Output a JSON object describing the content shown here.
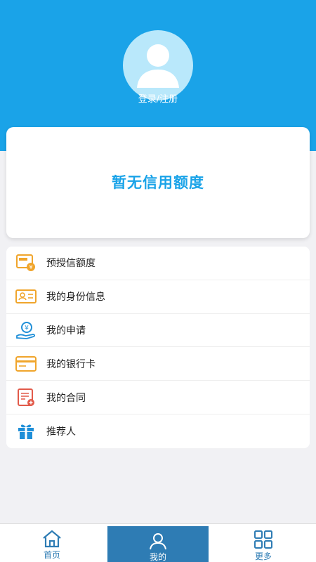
{
  "header": {
    "login_label": "登录/注册"
  },
  "credit": {
    "status_text": "暂无信用额度"
  },
  "menu": {
    "items": [
      {
        "label": "预授信额度",
        "icon": "pre-credit-icon"
      },
      {
        "label": "我的身份信息",
        "icon": "id-card-icon"
      },
      {
        "label": "我的申请",
        "icon": "yuan-hand-icon"
      },
      {
        "label": "我的银行卡",
        "icon": "bank-card-icon"
      },
      {
        "label": "我的合同",
        "icon": "contract-icon"
      },
      {
        "label": "推荐人",
        "icon": "gift-icon"
      }
    ]
  },
  "tabbar": {
    "home": "首页",
    "mine": "我的",
    "more": "更多"
  },
  "colors": {
    "primary": "#1aa3e8",
    "tab_active": "#2e7cb4",
    "icon_orange": "#f0a52c",
    "icon_red": "#e25a4a",
    "icon_blue": "#1f8fd8"
  }
}
